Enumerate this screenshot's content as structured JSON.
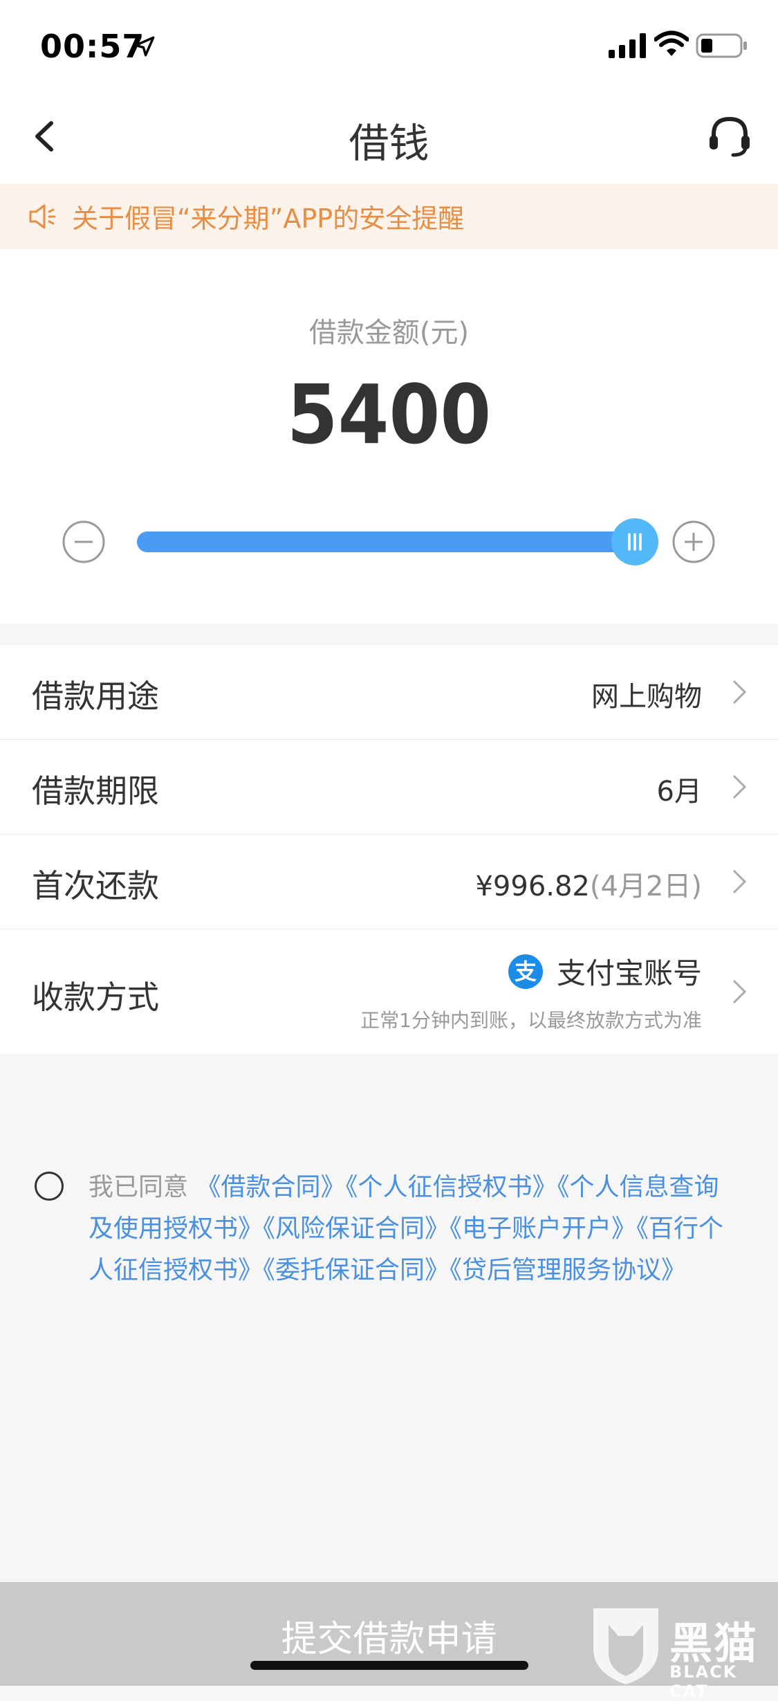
{
  "status_bar": {
    "time": "00:57"
  },
  "nav": {
    "title": "借钱"
  },
  "notice": {
    "text": "关于假冒“来分期”APP的安全提醒"
  },
  "amount": {
    "label": "借款金额(元)",
    "value": "5400",
    "slider_fraction": 1.0
  },
  "form": {
    "purpose": {
      "label": "借款用途",
      "value": "网上购物"
    },
    "term": {
      "label": "借款期限",
      "value": "6月"
    },
    "first_payment": {
      "label": "首次还款",
      "amount": "¥996.82",
      "date": "(4月2日)"
    },
    "receive": {
      "label": "收款方式",
      "icon_glyph": "支",
      "method": "支付宝账号",
      "note": "正常1分钟内到账，以最终放款方式为准"
    }
  },
  "agreement": {
    "prefix": "我已同意",
    "links": [
      "《借款合同》",
      "《个人征信授权书》",
      "《个人信息查询及使用授权书》",
      "《风险保证合同》",
      "《电子账户开户》",
      "《百行个人征信授权书》",
      "《委托保证合同》",
      "《贷后管理服务协议》"
    ]
  },
  "submit": {
    "label": "提交借款申请"
  },
  "watermark": {
    "text": "黑猫",
    "sub": "BLACK CAT"
  },
  "colors": {
    "accent": "#4a9cf3",
    "link": "#4a90e2",
    "notice": "#e98d43"
  }
}
